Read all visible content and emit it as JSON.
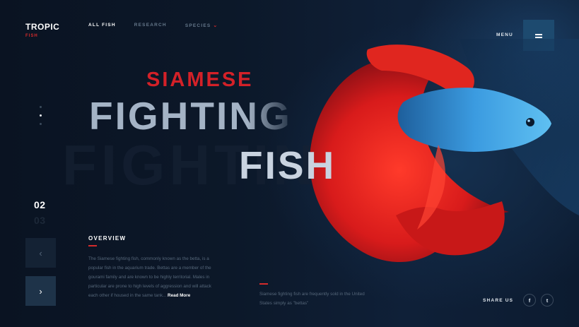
{
  "brand": {
    "name": "TROPIC",
    "sub": "FISH"
  },
  "nav": {
    "items": [
      {
        "label": "ALL FISH",
        "active": true
      },
      {
        "label": "RESEARCH",
        "active": false
      },
      {
        "label": "SPECIES",
        "active": false,
        "dropdown": true
      }
    ]
  },
  "menu": {
    "label": "MENU"
  },
  "slider": {
    "current": "02",
    "next": "03",
    "dots": 3,
    "active_dot": 2
  },
  "hero": {
    "line1": "SIAMESE",
    "line2": "FIGHTING",
    "line3": "FISH",
    "ghost": "FIGHTING"
  },
  "overview": {
    "label": "OVERVIEW",
    "text": "The Siamese fighting fish, commonly known as the betta, is a popular fish in the aquarium trade. Bettas are a member of the gourami family and are known to be highly territorial. Males in particular are prone to high levels of aggression and will attack each other if housed in the same tank...",
    "read_more": "Read More"
  },
  "side_note": {
    "text": "Siamese fighting fish are frequently sold in the United States simply as \"bettas\""
  },
  "share": {
    "label": "SHARE US",
    "facebook": "f",
    "twitter": "t"
  },
  "icons": {
    "prev": "chevron-left-icon",
    "next": "chevron-right-icon",
    "menu": "hamburger-icon",
    "species": "chevron-down-icon"
  },
  "colors": {
    "accent": "#d42b2b",
    "background": "#0b1524",
    "menu_button": "#1d4a6f",
    "fish_body": "#2f7fc0",
    "fish_fins": "#e0201f"
  }
}
